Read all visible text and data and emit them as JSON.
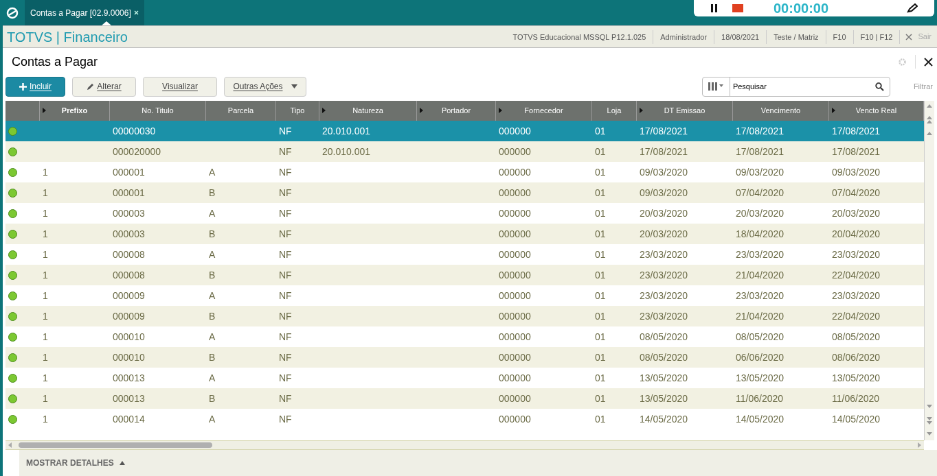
{
  "top_bar": {
    "tab": {
      "label": "Contas a Pagar [02.9.0006]",
      "selected": true
    },
    "recorder": {
      "timer": "00:00:00"
    }
  },
  "header": {
    "brand": "TOTVS | Financeiro",
    "info": [
      "TOTVS Educacional MSSQL P12.1.025",
      "Administrador",
      "18/08/2021",
      "Teste / Matriz",
      "F10",
      "F10 | F12"
    ],
    "exit": "Sair"
  },
  "page": {
    "title": "Contas a Pagar"
  },
  "toolbar": {
    "buttons": [
      {
        "kind": "primary",
        "label": "Incluir"
      },
      {
        "kind": "edit",
        "label": "Alterar"
      },
      {
        "kind": "plain",
        "label": "Visualizar"
      },
      {
        "kind": "dropdown",
        "label": "Outras Ações"
      }
    ],
    "search": {
      "placeholder": "Pesquisar"
    },
    "filter": "Filtrar"
  },
  "table": {
    "columns": [
      {
        "label": "Prefixo",
        "sort_marker": true,
        "bold": true
      },
      {
        "label": "No. Titulo",
        "sort_marker": false,
        "bold": false
      },
      {
        "label": "Parcela",
        "sort_marker": false,
        "bold": false
      },
      {
        "label": "Tipo",
        "sort_marker": false,
        "bold": false
      },
      {
        "label": "Natureza",
        "sort_marker": true,
        "bold": false
      },
      {
        "label": "Portador",
        "sort_marker": true,
        "bold": false
      },
      {
        "label": "Fornecedor",
        "sort_marker": true,
        "bold": false
      },
      {
        "label": "Loja",
        "sort_marker": false,
        "bold": false
      },
      {
        "label": "DT Emissao",
        "sort_marker": true,
        "bold": false
      },
      {
        "label": "Vencimento",
        "sort_marker": false,
        "bold": false
      },
      {
        "label": "Vencto Real",
        "sort_marker": true,
        "bold": false
      }
    ],
    "rows": [
      {
        "selected": true,
        "cells": [
          "",
          "00000030",
          "",
          "NF",
          "20.010.001",
          "",
          "000000",
          "01",
          "17/08/2021",
          "17/08/2021",
          "17/08/2021"
        ]
      },
      {
        "selected": false,
        "cells": [
          "",
          "000020000",
          "",
          "NF",
          "20.010.001",
          "",
          "000000",
          "01",
          "17/08/2021",
          "17/08/2021",
          "17/08/2021"
        ]
      },
      {
        "selected": false,
        "cells": [
          "1",
          "000001",
          "A",
          "NF",
          "",
          "",
          "000000",
          "01",
          "09/03/2020",
          "09/03/2020",
          "09/03/2020"
        ]
      },
      {
        "selected": false,
        "cells": [
          "1",
          "000001",
          "B",
          "NF",
          "",
          "",
          "000000",
          "01",
          "09/03/2020",
          "07/04/2020",
          "07/04/2020"
        ]
      },
      {
        "selected": false,
        "cells": [
          "1",
          "000003",
          "A",
          "NF",
          "",
          "",
          "000000",
          "01",
          "20/03/2020",
          "20/03/2020",
          "20/03/2020"
        ]
      },
      {
        "selected": false,
        "cells": [
          "1",
          "000003",
          "B",
          "NF",
          "",
          "",
          "000000",
          "01",
          "20/03/2020",
          "18/04/2020",
          "20/04/2020"
        ]
      },
      {
        "selected": false,
        "cells": [
          "1",
          "000008",
          "A",
          "NF",
          "",
          "",
          "000000",
          "01",
          "23/03/2020",
          "23/03/2020",
          "23/03/2020"
        ]
      },
      {
        "selected": false,
        "cells": [
          "1",
          "000008",
          "B",
          "NF",
          "",
          "",
          "000000",
          "01",
          "23/03/2020",
          "21/04/2020",
          "22/04/2020"
        ]
      },
      {
        "selected": false,
        "cells": [
          "1",
          "000009",
          "A",
          "NF",
          "",
          "",
          "000000",
          "01",
          "23/03/2020",
          "23/03/2020",
          "23/03/2020"
        ]
      },
      {
        "selected": false,
        "cells": [
          "1",
          "000009",
          "B",
          "NF",
          "",
          "",
          "000000",
          "01",
          "23/03/2020",
          "21/04/2020",
          "22/04/2020"
        ]
      },
      {
        "selected": false,
        "cells": [
          "1",
          "000010",
          "A",
          "NF",
          "",
          "",
          "000000",
          "01",
          "08/05/2020",
          "08/05/2020",
          "08/05/2020"
        ]
      },
      {
        "selected": false,
        "cells": [
          "1",
          "000010",
          "B",
          "NF",
          "",
          "",
          "000000",
          "01",
          "08/05/2020",
          "06/06/2020",
          "08/06/2020"
        ]
      },
      {
        "selected": false,
        "cells": [
          "1",
          "000013",
          "A",
          "NF",
          "",
          "",
          "000000",
          "01",
          "13/05/2020",
          "13/05/2020",
          "13/05/2020"
        ]
      },
      {
        "selected": false,
        "cells": [
          "1",
          "000013",
          "B",
          "NF",
          "",
          "",
          "000000",
          "01",
          "13/05/2020",
          "11/06/2020",
          "11/06/2020"
        ]
      },
      {
        "selected": false,
        "cells": [
          "1",
          "000014",
          "A",
          "NF",
          "",
          "",
          "000000",
          "01",
          "14/05/2020",
          "14/05/2020",
          "14/05/2020"
        ]
      }
    ]
  },
  "details_toggle": "MOSTRAR DETALHES"
}
